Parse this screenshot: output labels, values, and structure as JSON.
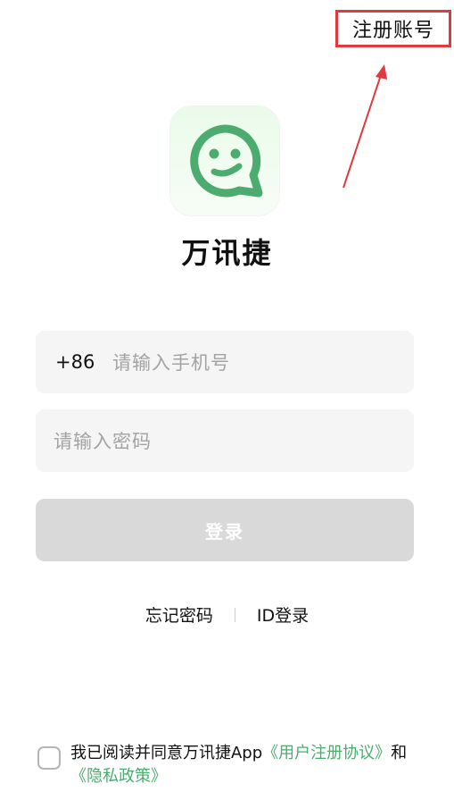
{
  "header": {
    "register_label": "注册账号"
  },
  "app": {
    "name": "万讯捷",
    "logo_icon": "smiley-chat-bubble-icon",
    "brand_color": "#4cac6f"
  },
  "form": {
    "country_code": "+86",
    "phone_placeholder": "请输入手机号",
    "password_placeholder": "请输入密码",
    "login_label": "登录"
  },
  "links": {
    "forgot_password": "忘记密码",
    "id_login": "ID登录"
  },
  "agreement": {
    "prefix": "我已阅读并同意万讯捷App",
    "user_agreement": "《用户注册协议》",
    "conjunction": "和",
    "privacy_policy": "《隐私政策》"
  },
  "colors": {
    "annotation_red": "#e03a3e",
    "disabled_button": "#d9d9d9"
  }
}
